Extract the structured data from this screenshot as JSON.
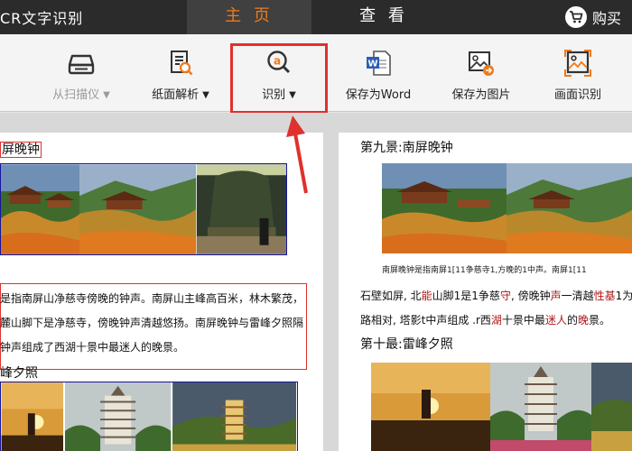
{
  "app": {
    "title": "CR文字识别"
  },
  "tabs": {
    "home": "主 页",
    "view": "查 看"
  },
  "buy": {
    "label": "购买",
    "icon": "cart-icon"
  },
  "toolbar": {
    "scanner": {
      "label": "从扫描仪",
      "icon": "scanner-icon"
    },
    "page_analysis": {
      "label": "纸面解析",
      "icon": "page-analysis-icon"
    },
    "recognize": {
      "label": "识别",
      "icon": "recognize-icon"
    },
    "save_word": {
      "label": "保存为Word",
      "icon": "word-icon"
    },
    "save_image": {
      "label": "保存为图片",
      "icon": "save-image-icon"
    },
    "screen_ocr": {
      "label": "画面识别",
      "icon": "screen-capture-icon"
    }
  },
  "left_page": {
    "heading1": "屏晚钟",
    "para_lines": [
      "是指南屏山净慈寺傍晚的钟声。南屏山主峰高百米，林木繁茂，",
      "麓山脚下是净慈寺，傍晚钟声清越悠扬。南屏晚钟与雷峰夕照隔",
      "钟声组成了西湖十景中最迷人的晚景。"
    ],
    "heading2": "峰夕照"
  },
  "right_page": {
    "heading1": "第九景:南屏晚钟",
    "caption": "南屏晚钟是指南屏1[11争慈寺1,方晚的1中声。南屏1[11",
    "ocr_line1": [
      "石壁如屏, 北",
      "能",
      "山脚1是1争慈",
      "守",
      ", 傍晚钟",
      "声",
      "一清越",
      "性基",
      "1为。"
    ],
    "ocr_line2": [
      "路相对, 塔影t中声组成 .r西",
      "湖",
      "十景中最",
      "迷人",
      "的",
      "晚",
      "景。"
    ],
    "heading2": "第十最:雷峰夕照"
  },
  "colors": {
    "accent": "#f07a1a",
    "highlight": "#e0312c",
    "topbar": "#2b2b2b",
    "frame": "#1515a0"
  }
}
